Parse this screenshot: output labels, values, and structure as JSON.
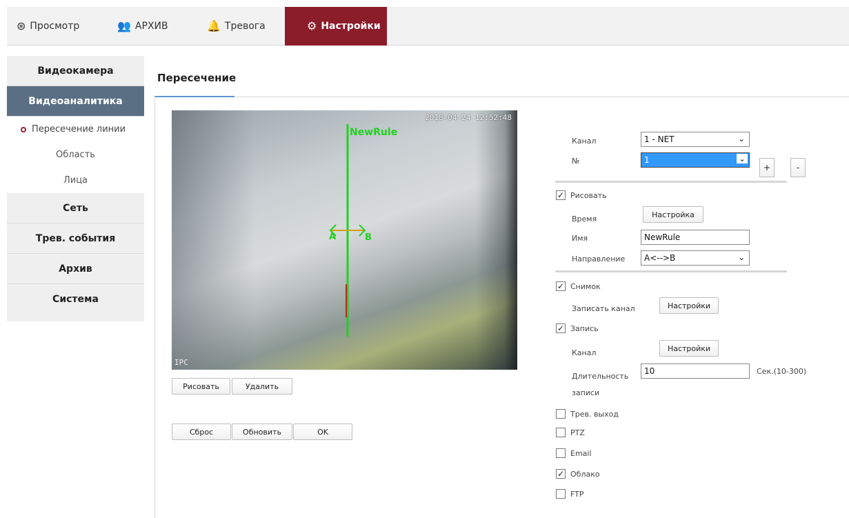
{
  "nav": {
    "view": "Просмотр",
    "archive": "АРХИВ",
    "alarm": "Тревога",
    "settings": "Настройки",
    "accent": "#8b1c2a"
  },
  "sidebar": {
    "camera": "Видеокамера",
    "analytics": "Видеоаналитика",
    "items": [
      "Пересечение линии",
      "Область",
      "Лица"
    ],
    "network": "Сеть",
    "alarm_events": "Трев. события",
    "archive": "Архив",
    "system": "Система"
  },
  "page": {
    "title": "Пересечение"
  },
  "video": {
    "timestamp": "2018-04-24 12:52:48",
    "corner": "IPC",
    "rule_name": "NewRule",
    "label_a": "A",
    "label_b": "B"
  },
  "video_buttons": {
    "draw": "Рисовать",
    "delete": "Удалить"
  },
  "form_buttons": {
    "reset": "Сброс",
    "refresh": "Обновить",
    "ok": "OK"
  },
  "form": {
    "channel_label": "Канал",
    "channel_value": "1 - NET",
    "number_label": "№",
    "number_value": "1",
    "plus": "+",
    "minus": "-",
    "draw_label": "Рисовать",
    "time_label": "Время",
    "time_button": "Настройка",
    "name_label": "Имя",
    "name_value": "NewRule",
    "direction_label": "Направление",
    "direction_value": "A<-->B",
    "snapshot_label": "Снимок",
    "record_channel_label": "Записать канал",
    "record_channel_button": "Настройки",
    "record_label": "Запись",
    "channel2_label": "Канал",
    "channel2_button": "Настройки",
    "duration_label": "Длительность",
    "duration_label2": "записи",
    "duration_value": "10",
    "duration_unit": "Сек.(10-300)",
    "alarm_out_label": "Трев. выход",
    "ptz_label": "PTZ",
    "email_label": "Email",
    "cloud_label": "Облако",
    "ftp_label": "FTP",
    "checks": {
      "draw": true,
      "snapshot": true,
      "record": true,
      "alarm_out": false,
      "ptz": false,
      "email": false,
      "cloud": true,
      "ftp": false
    }
  }
}
